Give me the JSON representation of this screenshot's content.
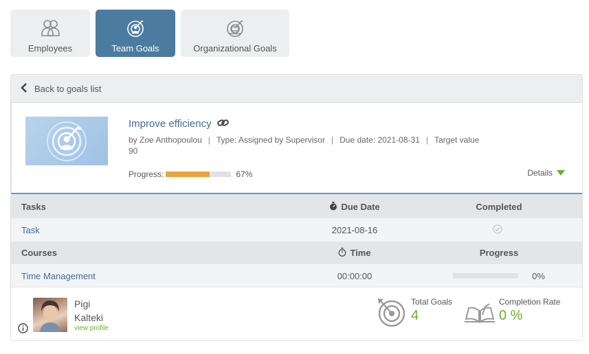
{
  "tabs": [
    {
      "label": "Employees",
      "icon": "users-icon",
      "active": false
    },
    {
      "label": "Team Goals",
      "icon": "target-team-icon",
      "active": true
    },
    {
      "label": "Organizational Goals",
      "icon": "target-org-icon",
      "active": false
    }
  ],
  "back": {
    "label": "Back to goals list"
  },
  "goal": {
    "title": "Improve efficiency",
    "author": "by Zoe Anthopoulou",
    "type": "Type: Assigned by Supervisor",
    "due": "Due date: 2021-08-31",
    "target_label": "Target value",
    "target_value": "90",
    "progress_label": "Progress:",
    "progress_text": "67%",
    "progress_fraction": 0.67,
    "details_label": "Details"
  },
  "tasks": {
    "headers": {
      "name": "Tasks",
      "due": "Due Date",
      "completed": "Completed"
    },
    "rows": [
      {
        "name": "Task",
        "due": "2021-08-16",
        "completed": true
      }
    ]
  },
  "courses": {
    "headers": {
      "name": "Courses",
      "time": "Time",
      "progress": "Progress"
    },
    "rows": [
      {
        "name": "Time Management",
        "time": "00:00:00",
        "progress_text": "0%",
        "progress_fraction": 0
      }
    ]
  },
  "person": {
    "first": "Pigi",
    "last": "Kalteki",
    "view_profile": "view profile"
  },
  "stats": {
    "total_goals_label": "Total Goals",
    "total_goals_value": "4",
    "completion_rate_label": "Completion Rate",
    "completion_rate_value": "0 %"
  },
  "colors": {
    "accent": "#4b7c9f",
    "link": "#3e6c97",
    "progress": "#e8a53a",
    "success": "#6ab02c",
    "details_arrow": "#6ab02c"
  }
}
